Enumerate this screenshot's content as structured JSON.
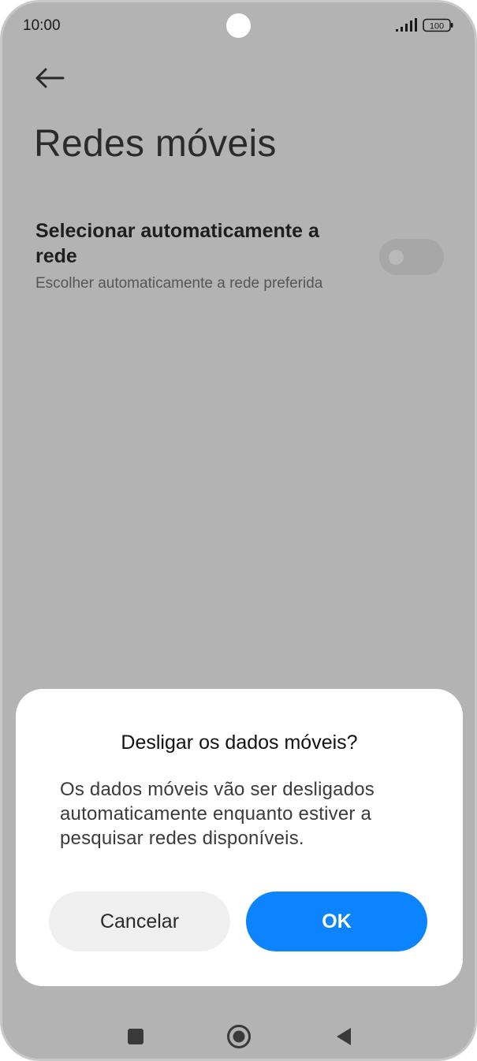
{
  "status_bar": {
    "time": "10:00",
    "battery": "100"
  },
  "page": {
    "title": "Redes móveis",
    "back_icon": "arrow-left-icon"
  },
  "setting": {
    "title": "Selecionar automaticamente a rede",
    "description": "Escolher automaticamente a rede preferida",
    "toggle_on": false
  },
  "dialog": {
    "title": "Desligar os dados móveis?",
    "message": "Os dados móveis vão ser desligados automaticamente enquanto estiver a pesquisar redes disponíveis.",
    "cancel_label": "Cancelar",
    "ok_label": "OK"
  },
  "navigation": {
    "recents_icon": "square-icon",
    "home_icon": "circle-home-icon",
    "back_icon": "triangle-back-icon"
  },
  "colors": {
    "accent": "#0d84ff",
    "scrim": "#b3b3b3"
  }
}
